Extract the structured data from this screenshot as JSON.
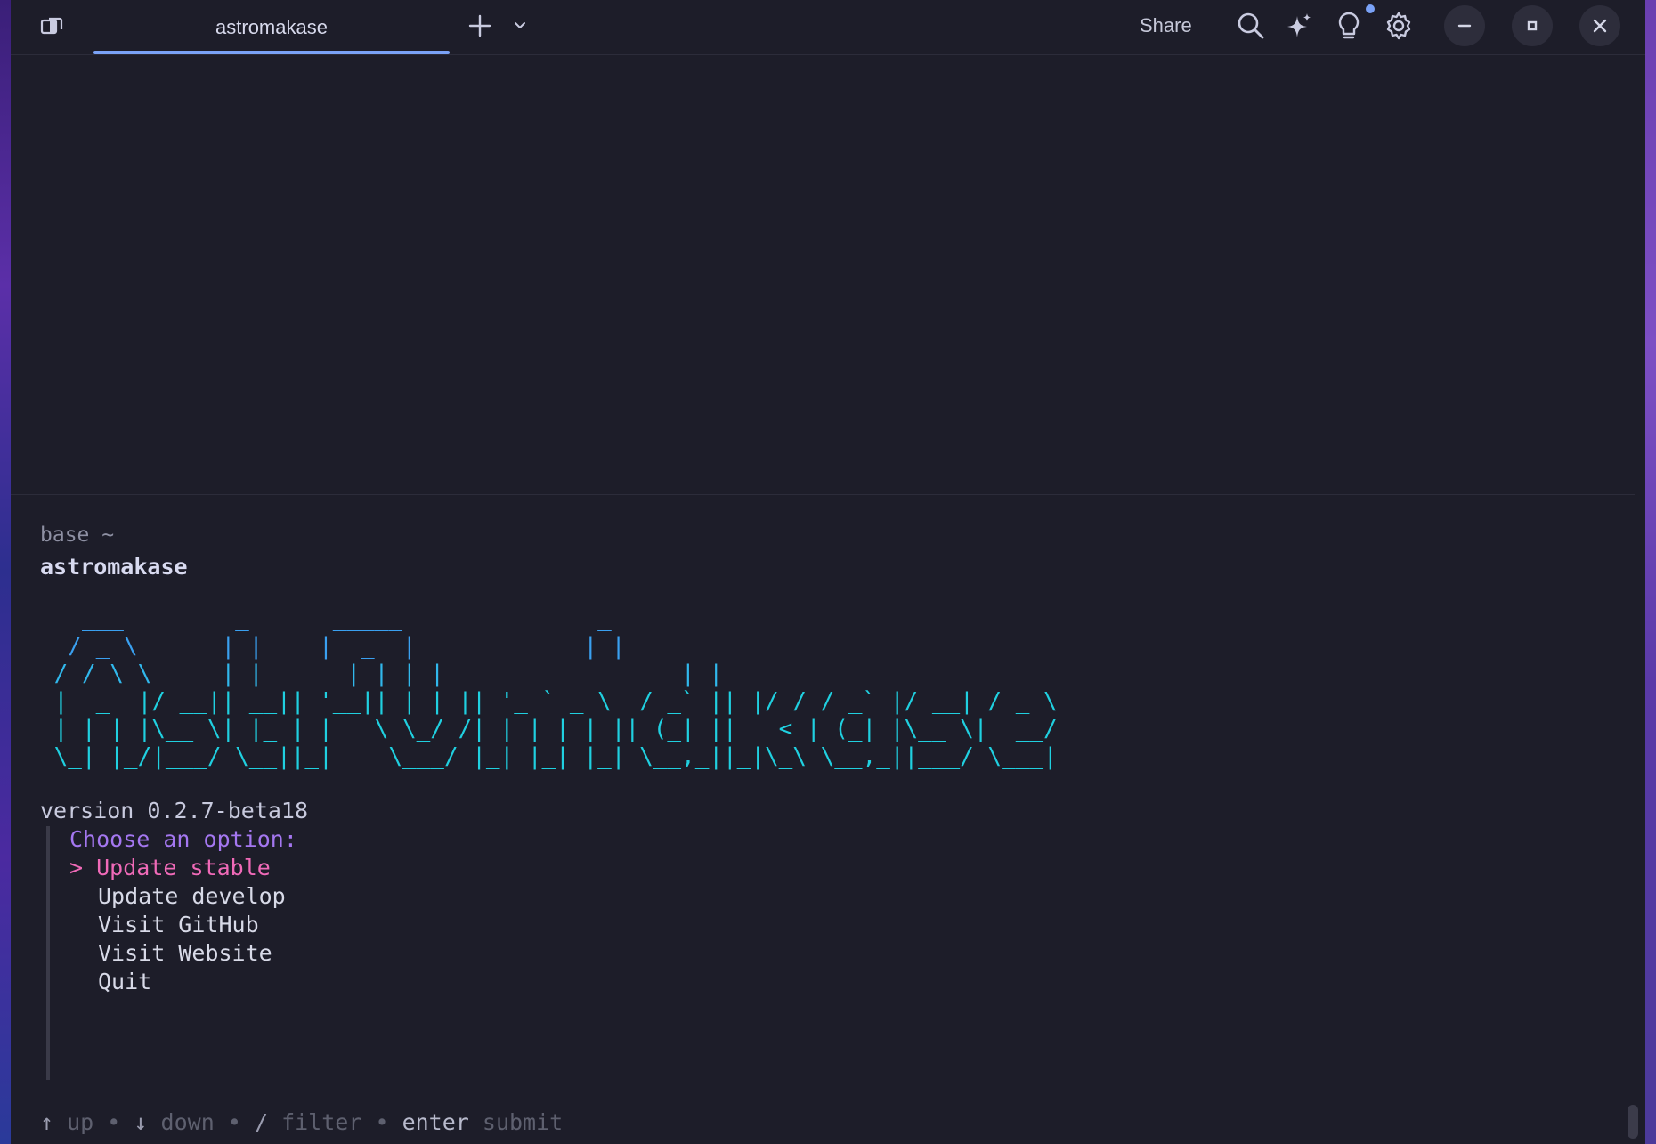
{
  "window": {
    "tab_title": "astromakase",
    "share_label": "Share"
  },
  "terminal": {
    "prompt_context": "base ~",
    "command": "astromakase",
    "ascii_banner": [
      "   ___        _      _____              _",
      "  / _ \\      | |    |  _  |            | |",
      " / /_\\ \\ ___ | |_ _ __| | | | _ __ ___   __ _ | | __  __ _  ___  ___",
      " |  _  |/ __|| __|| '__|| | | || '_ ` _ \\  / _` || |/ / / _` |/ __| / _ \\",
      " | | | |\\__ \\| |_ | |   \\ \\_/ /| | | | | || (_| ||   < | (_| |\\__ \\|  __/",
      " \\_| |_/|___/ \\__||_|    \\___/ |_| |_| |_| \\__,_||_|\\_\\ \\__,_||___/ \\___|"
    ],
    "version_line": "version 0.2.7-beta18",
    "menu": {
      "title": "Choose an option:",
      "cursor": ">",
      "items": [
        "Update stable",
        "Update develop",
        "Visit GitHub",
        "Visit Website",
        "Quit"
      ],
      "selected_index": 0
    },
    "help": {
      "up_key": "↑",
      "up_label": "up",
      "down_key": "↓",
      "down_label": "down",
      "filter_key": "/",
      "filter_label": "filter",
      "enter_key": "enter",
      "enter_label": "submit",
      "separator": "•"
    }
  },
  "colors": {
    "background": "#1d1d29",
    "accent": "#7aa2f7",
    "menu_title": "#a477f0",
    "menu_selected": "#f06ab8",
    "banner": "#20d0e0"
  },
  "icons": [
    "panel-toggle-icon",
    "plus-icon",
    "chevron-down-icon",
    "search-icon",
    "sparkle-icon",
    "lightbulb-icon",
    "gear-icon",
    "minimize-icon",
    "maximize-icon",
    "close-icon"
  ]
}
